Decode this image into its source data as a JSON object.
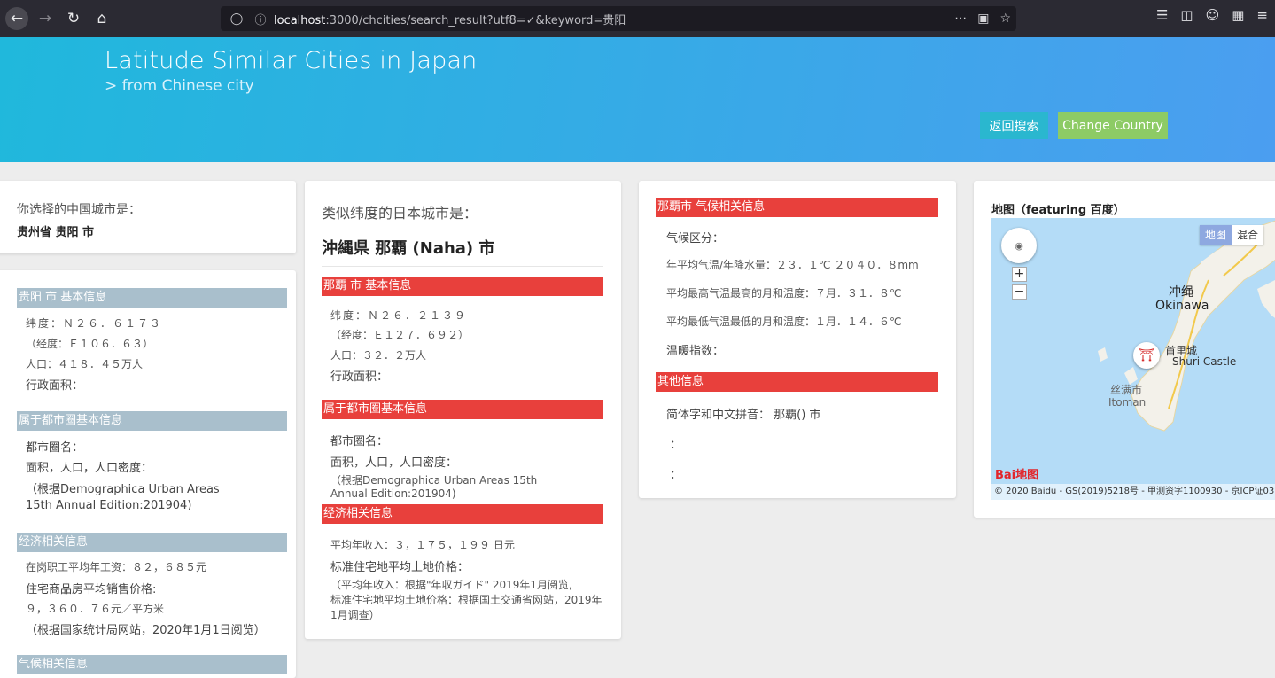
{
  "browser": {
    "url_host": "localhost",
    "url_rest": ":3000/chcities/search_result?utf8=✓&keyword=贵阳"
  },
  "header": {
    "title": "Latitude Similar Cities in Japan",
    "subtitle": "> from Chinese city",
    "back_button": "返回搜索",
    "change_country_button": "Change Country"
  },
  "chinese_city": {
    "label": "你选择的中国城市是：",
    "value": "贵州省 贵阳 市"
  },
  "chinese_info": {
    "basic_title": "贵阳 市 基本信息",
    "latitude": "纬度：Ｎ２６．６１７３",
    "longitude": "（经度：Ｅ１０６．６３）",
    "population": "人口：４１８．４５万人",
    "area": "行政面积：",
    "metro_title": "属于都市圈基本信息",
    "metro_name": "都市圈名：",
    "metro_stats": "面积，人口，人口密度：",
    "metro_source1": "（根据Demographica Urban Areas",
    "metro_source2": "15th Annual Edition:201904)",
    "econ_title": "经济相关信息",
    "wage": "在岗职工平均年工资：８２，６８５元",
    "housing": "住宅商品房平均销售价格:",
    "housing_val": "９，３６０．７６元／平方米",
    "econ_source": "（根据国家统计局网站，2020年1月1日阅览）",
    "climate_title": "气候相关信息"
  },
  "japan_city": {
    "heading": "类似纬度的日本城市是：",
    "city": "沖縄県 那覇 (Naha) 市",
    "basic_title": "那覇 市 基本信息",
    "latitude": "纬度：Ｎ２６．２１３９",
    "longitude": "（经度：Ｅ１２７．６９２）",
    "population": "人口：３２．２万人",
    "area": "行政面积：",
    "metro_title": "属于都市圈基本信息",
    "metro_name": "都市圈名：",
    "metro_stats": "面积，人口，人口密度：",
    "metro_source1": "（根据Demographica Urban Areas 15th",
    "metro_source2": "Annual Edition:201904)",
    "econ_title": "经济相关信息",
    "income": "平均年收入：３，１７５，１９９ 日元",
    "land": "标准住宅地平均土地价格：",
    "econ_source1": "（平均年收入：根据\"年収ガイド\" 2019年1月阅览,",
    "econ_source2": "标准住宅地平均土地价格：根据国土交通省网站，2019年",
    "econ_source3": "1月调查）"
  },
  "japan_climate": {
    "title": "那覇市 气候相关信息",
    "zone": "气候区分：",
    "annual": "年平均气温/年降水量：２３．１℃ ２０４０．８mm",
    "max": "平均最高气温最高的月和温度：７月．３１．８℃",
    "min": "平均最低气温最低的月和温度：１月．１４．６℃",
    "warmth": "温暖指数：",
    "other_title": "其他信息",
    "simplified": "简体字和中文拼音： 那覇() 市",
    "colon1": "：",
    "colon2": "："
  },
  "map": {
    "title": "地图（featuring 百度）",
    "type_map": "地图",
    "type_hybrid": "混合",
    "label_okinawa_cn": "冲绳",
    "label_okinawa_en": "Okinawa",
    "label_shuri_cn": "首里城",
    "label_shuri_en": "Shuri Castle",
    "label_itoman_cn": "丝满市",
    "label_itoman_en": "Itoman",
    "logo": "Bai地图",
    "copyright": "© 2020 Baidu - GS(2019)5218号 - 甲测资字1100930 - 京ICP证03"
  }
}
